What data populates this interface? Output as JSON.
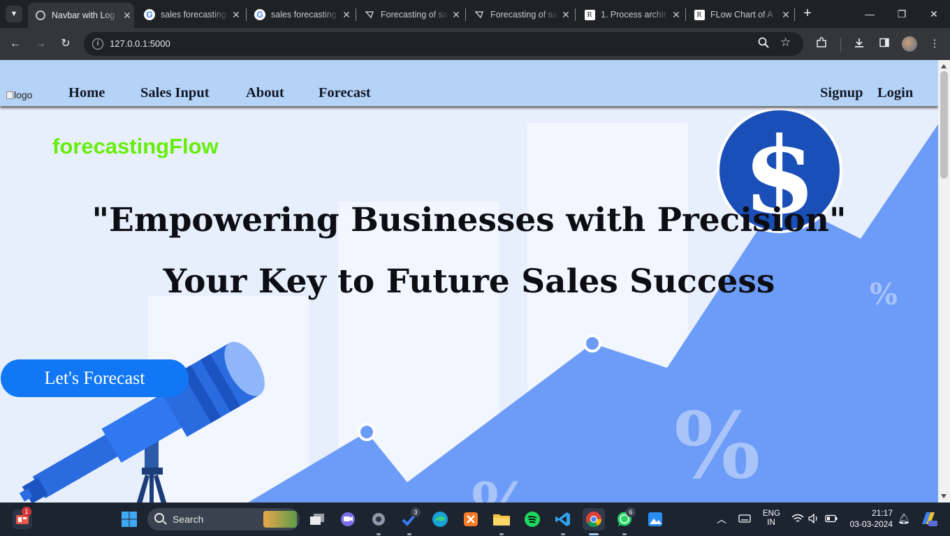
{
  "browser": {
    "tabs": [
      {
        "title": "Navbar with Log",
        "favicon": "globe-icon",
        "active": true
      },
      {
        "title": "sales forecasting",
        "favicon": "google-icon",
        "active": false
      },
      {
        "title": "sales forecasting",
        "favicon": "google-icon",
        "active": false
      },
      {
        "title": "Forecasting of sa",
        "favicon": "chatgpt-icon",
        "active": false
      },
      {
        "title": "Forecasting of sa",
        "favicon": "chatgpt-icon",
        "active": false
      },
      {
        "title": "1. Process archit",
        "favicon": "researchgate-icon",
        "active": false
      },
      {
        "title": "FLow Chart of A",
        "favicon": "researchgate-icon",
        "active": false
      }
    ],
    "favicon_letter_g": "G",
    "favicon_letter_r": "R",
    "favicon_r_sup": "G",
    "new_tab": "+",
    "url": "127.0.0.1:5000"
  },
  "site": {
    "logo_alt": "logo",
    "nav": {
      "home": "Home",
      "sales_input": "Sales Input",
      "about": "About",
      "forecast": "Forecast",
      "signup": "Signup",
      "login": "Login"
    },
    "brand": "forecastingFlow",
    "headline_1": "\"Empowering Businesses with Precision\"",
    "headline_2": "Your Key to Future Sales Success",
    "cta": "Let's Forecast",
    "decor": {
      "dollar": "$",
      "percent": "%"
    }
  },
  "taskbar": {
    "search_label": "Search",
    "badges": {
      "widgets": "1",
      "todo": "3",
      "whatsapp": "6"
    },
    "language": "ENG",
    "region": "IN",
    "time": "21:17",
    "date": "03-03-2024"
  },
  "colors": {
    "nav_bg": "#b5d3f6",
    "brand": "#66ee0a",
    "cta": "#1177f5",
    "chart_area": "#6d9cf8",
    "dollar_circle": "#1b4fb8"
  }
}
